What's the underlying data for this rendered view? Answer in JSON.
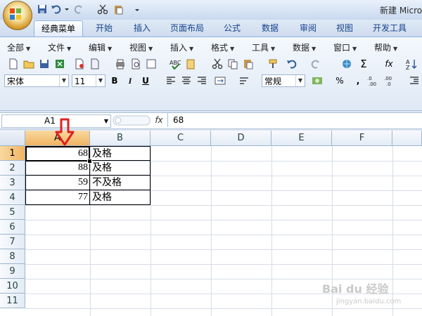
{
  "title": "新建 Micro",
  "ribbon_tabs": [
    "经典菜单",
    "开始",
    "插入",
    "页面布局",
    "公式",
    "数据",
    "审阅",
    "视图",
    "开发工具"
  ],
  "active_tab": 0,
  "classic_menus": [
    "全部",
    "文件",
    "编辑",
    "视图",
    "插入",
    "格式",
    "工具",
    "数据",
    "窗口",
    "帮助"
  ],
  "font_name": "宋体",
  "font_size": "11",
  "format_buttons": {
    "bold": "B",
    "italic": "I",
    "underline": "U"
  },
  "number_format": "常规",
  "sigma": "Σ",
  "fx_label": "fx",
  "name_box": "A1",
  "formula_value": "68",
  "columns": [
    "A",
    "B",
    "C",
    "D",
    "E",
    "F"
  ],
  "rows": [
    "1",
    "2",
    "3",
    "4",
    "5",
    "6",
    "7",
    "8",
    "9",
    "10",
    "11"
  ],
  "cells": [
    {
      "a": "68",
      "b": "及格"
    },
    {
      "a": "88",
      "b": "及格"
    },
    {
      "a": "59",
      "b": "不及格"
    },
    {
      "a": "77",
      "b": "及格"
    }
  ],
  "watermark": "Bai du 经验",
  "watermark_sub": "jingyan.baidu.com",
  "colors": {
    "accent": "#15428b",
    "selected_header": "#f1b463",
    "arrow": "#e02020"
  }
}
